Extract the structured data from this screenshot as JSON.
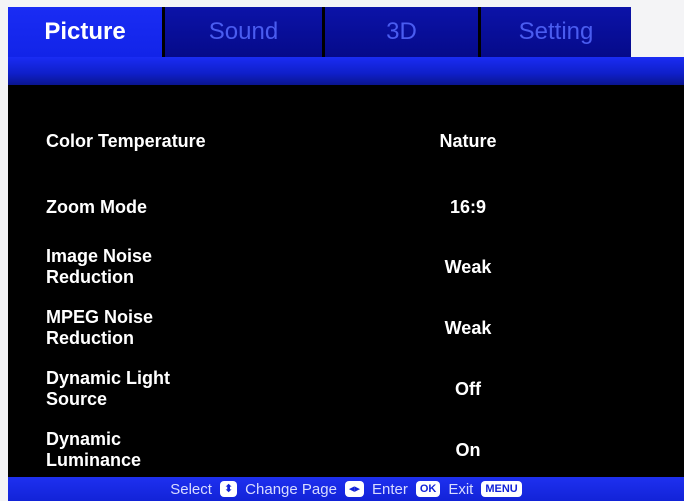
{
  "tabs": [
    {
      "label": "Picture",
      "active": true
    },
    {
      "label": "Sound",
      "active": false
    },
    {
      "label": "3D",
      "active": false
    },
    {
      "label": "Setting",
      "active": false
    }
  ],
  "menu": [
    {
      "label": "Color Temperature",
      "value": "Nature"
    },
    {
      "label": "Zoom Mode",
      "value": "16:9"
    },
    {
      "label": "Image Noise\nReduction",
      "value": "Weak"
    },
    {
      "label": "MPEG Noise\nReduction",
      "value": "Weak"
    },
    {
      "label": "Dynamic Light\nSource",
      "value": "Off"
    },
    {
      "label": "Dynamic\nLuminance",
      "value": "On"
    }
  ],
  "hint": {
    "select": "Select",
    "select_key": "⬍",
    "change_page": "Change Page",
    "change_page_key": "◂▸",
    "enter": "Enter",
    "enter_key": "OK",
    "exit": "Exit",
    "exit_key": "MENU"
  },
  "colors": {
    "active_tab": "#1a2cf4",
    "inactive_tab": "#0c13a8",
    "inactive_tab_text": "#4a5cf0",
    "background": "#000000"
  }
}
